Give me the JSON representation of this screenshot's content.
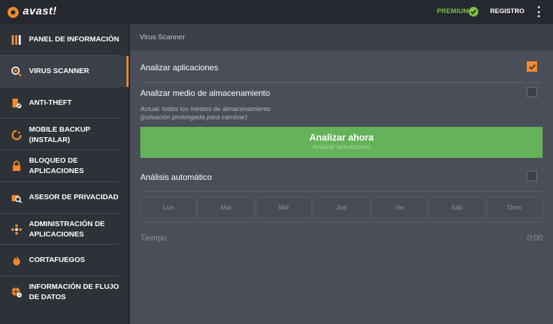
{
  "app": {
    "logo_text": "avast!",
    "premium_label": "PREMIUM",
    "registro_label": "REGISTRO"
  },
  "sidebar": {
    "items": [
      {
        "label": "PANEL DE INFORMACIÓN",
        "icon": "dashboard-icon"
      },
      {
        "label": "VIRUS SCANNER",
        "icon": "scan-icon",
        "active": true
      },
      {
        "label": "ANTI-THEFT",
        "icon": "phone-theft-icon"
      },
      {
        "label": "MOBILE BACKUP (INSTALAR)",
        "icon": "backup-icon"
      },
      {
        "label": "BLOQUEO DE APLICACIONES",
        "icon": "lock-icon"
      },
      {
        "label": "ASESOR DE PRIVACIDAD",
        "icon": "privacy-icon"
      },
      {
        "label": "ADMINISTRACIÓN DE APLICACIONES",
        "icon": "apps-admin-icon"
      },
      {
        "label": "CORTAFUEGOS",
        "icon": "firewall-icon"
      },
      {
        "label": "INFORMACIÓN DE FLUJO DE DATOS",
        "icon": "data-flow-icon"
      }
    ]
  },
  "main": {
    "header": "Virus Scanner",
    "scan_apps": {
      "label": "Analizar aplicaciones",
      "checked": true
    },
    "scan_storage": {
      "label": "Analizar medio de almacenamiento",
      "checked": false,
      "hint_current": "Actual: todos los medios de almacenamiento",
      "hint_action": "(pulsación prolongada para cambiar)"
    },
    "scan_button": {
      "label": "Analizar ahora",
      "sublabel": "Analizar aplicaciones"
    },
    "auto_scan": {
      "label": "Análisis automático",
      "checked": false
    },
    "days": [
      "Lun",
      "Mar",
      "Mié",
      "Jue",
      "Vie",
      "Sáb",
      "Dom"
    ],
    "time": {
      "label": "Tiempo",
      "value": "0:00"
    }
  },
  "colors": {
    "accent": "#f08a2c",
    "premium_green": "#7cc145",
    "button_green": "#64b25a"
  }
}
